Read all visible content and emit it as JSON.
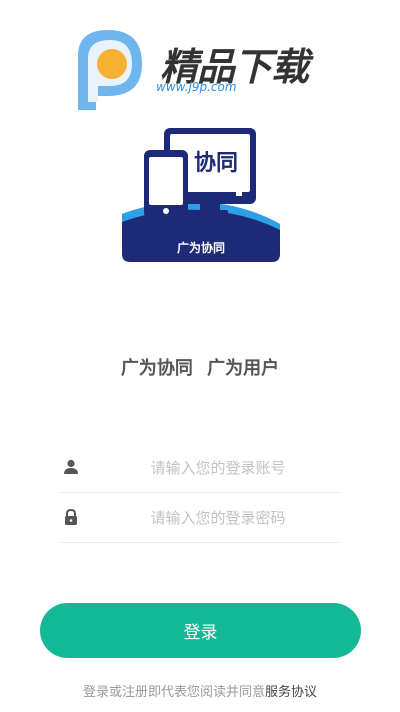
{
  "watermark": {
    "title": "精品下载",
    "url": "www.j9p.com"
  },
  "logo": {
    "screen_text": "协同",
    "banner_text": "广为协同"
  },
  "slogan": {
    "part1": "广为协同",
    "part2": "广为用户"
  },
  "form": {
    "username_placeholder": "请输入您的登录账号",
    "password_placeholder": "请输入您的登录密码"
  },
  "login_button": "登录",
  "agreement": {
    "prefix": "登录或注册即代表您阅读并同意",
    "link": "服务协议"
  },
  "colors": {
    "accent": "#13b896",
    "navy": "#1d2a78",
    "logo_sky": "#2ea0e8"
  }
}
